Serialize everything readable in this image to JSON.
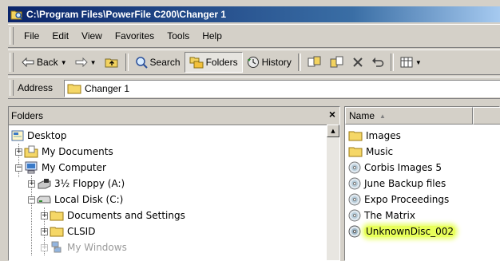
{
  "window": {
    "title": "C:\\Program Files\\PowerFile C200\\Changer 1"
  },
  "menu": [
    "File",
    "Edit",
    "View",
    "Favorites",
    "Tools",
    "Help"
  ],
  "toolbar": {
    "back": "Back",
    "search": "Search",
    "folders": "Folders",
    "history": "History"
  },
  "address": {
    "label": "Address",
    "value": "Changer 1"
  },
  "folders_pane": {
    "title": "Folders",
    "close": "×",
    "tree": [
      {
        "label": "Desktop",
        "icon": "desktop-icon"
      },
      {
        "label": "My Documents",
        "icon": "my-documents-icon"
      },
      {
        "label": "My Computer",
        "icon": "my-computer-icon"
      },
      {
        "label": "3½ Floppy (A:)",
        "icon": "floppy-icon"
      },
      {
        "label": "Local Disk (C:)",
        "icon": "local-disk-icon"
      },
      {
        "label": "Documents and Settings",
        "icon": "folder-icon"
      },
      {
        "label": "CLSID",
        "icon": "folder-icon"
      },
      {
        "label": "My Windows",
        "icon": "network-folder-icon"
      }
    ]
  },
  "list_pane": {
    "column": "Name",
    "items": [
      {
        "label": "Images",
        "icon": "folder-icon"
      },
      {
        "label": "Music",
        "icon": "folder-icon"
      },
      {
        "label": "Corbis Images 5",
        "icon": "disc-icon"
      },
      {
        "label": "June Backup files",
        "icon": "disc-icon"
      },
      {
        "label": "Expo Proceedings",
        "icon": "disc-icon"
      },
      {
        "label": "The Matrix",
        "icon": "disc-icon"
      },
      {
        "label": "UnknownDisc_002",
        "icon": "disc-icon",
        "highlighted": true
      }
    ]
  },
  "colors": {
    "title_gradient_start": "#0a246a",
    "title_gradient_end": "#a6caf0",
    "highlight": "#e8ff5a",
    "chrome": "#d4d0c8"
  }
}
